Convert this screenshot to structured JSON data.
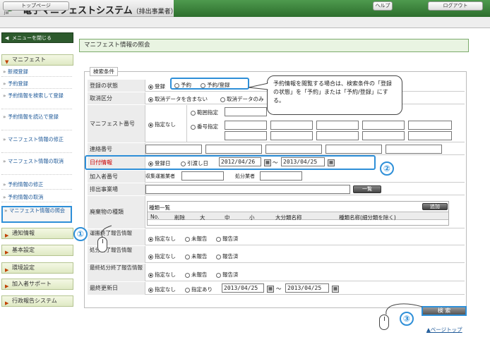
{
  "header": {
    "title": "電子マニフェストシステム",
    "subtitle": "（排出事業者）"
  },
  "nav": {
    "top_page": "トップページ",
    "help": "ヘルプ",
    "logout": "ログアウト"
  },
  "sidebar": {
    "toggle": "メニューを閉じる",
    "manifest_cat": "マニフェスト",
    "items": [
      "新規登録",
      "予約登録",
      "予約情報を検索して登録",
      "予約情報を読込で登録",
      "マニフェスト情報の修正",
      "マニフェスト情報の取消",
      "予約情報の修正",
      "予約情報の取消",
      "マニフェスト情報の照会"
    ],
    "cats": [
      "通知情報",
      "基本設定",
      "環境設定",
      "加入者サポート",
      "行政報告システム"
    ]
  },
  "main": {
    "heading": "マニフェスト情報の照会",
    "legend": "検索条件",
    "labels": {
      "status": "登録の状態",
      "cancel": "取消区分",
      "manifest_no": "マニフェスト番号",
      "contact_no": "連絡番号",
      "date_info": "日付情報",
      "member_no": "加入者番号",
      "site": "排出事業場",
      "waste_type": "廃棄物の種類",
      "transport_report": "運搬終了報告情報",
      "disposal_report": "処分終了報告情報",
      "final_report": "最終処分終了報告情報",
      "last_update": "最終更新日"
    },
    "status_opts": [
      "登録",
      "予約",
      "予約/登録"
    ],
    "cancel_opts": [
      "取消データを含まない",
      "取消データのみ"
    ],
    "manifest_opts": [
      "指定なし",
      "範囲指定",
      "番号指定"
    ],
    "date_opts": [
      "登録日",
      "引渡し日"
    ],
    "date_from": "2012/04/26",
    "date_to": "2013/04/25",
    "tilde": "～",
    "member_labels": [
      "収集運搬業者",
      "処分業者"
    ],
    "list_btn": "一覧",
    "waste_list_title": "種類一覧",
    "add_btn": "追加",
    "waste_cols": [
      "No.",
      "削除",
      "大",
      "中",
      "小",
      "大分類名称",
      "種類名称(細分類を除く)"
    ],
    "report_opts": [
      "指定なし",
      "未報告",
      "報告済"
    ],
    "update_opts": [
      "指定なし",
      "指定あり"
    ],
    "update_from": "2013/04/25",
    "update_to": "2013/04/25",
    "search_btn": "検 索",
    "page_top": "▲ページトップ"
  },
  "tooltip": "予約情報を閲覧する場合は、検索条件の「登録の状態」を「予約」または「予約/登録」にする。",
  "callouts": [
    "①",
    "②",
    "③"
  ]
}
